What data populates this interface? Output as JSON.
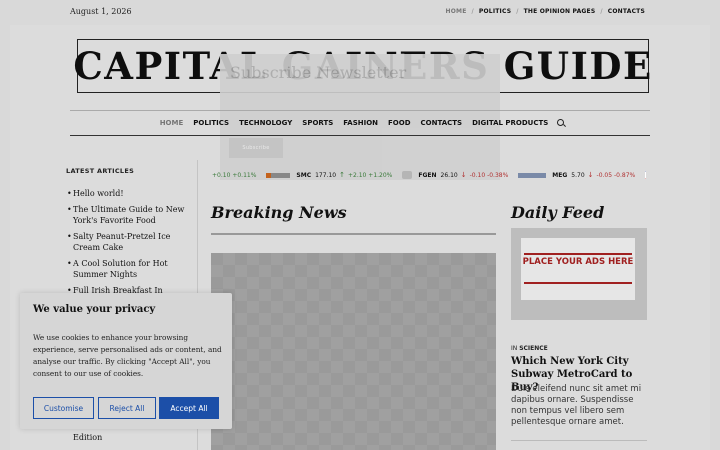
{
  "topbar": {
    "date": "August 1, 2026",
    "nav": [
      "HOME",
      "POLITICS",
      "THE OPINION PAGES",
      "CONTACTS"
    ]
  },
  "logo": {
    "title": "CAPITAL GAINERS GUIDE"
  },
  "newsletter_popup": {
    "title": "Subscribe Newsletter",
    "button": "Subscribe"
  },
  "mainnav": {
    "items": [
      "HOME",
      "POLITICS",
      "TECHNOLOGY",
      "SPORTS",
      "FASHION",
      "FOOD",
      "CONTACTS",
      "DIGITAL PRODUCTS"
    ],
    "search_icon": "search-icon"
  },
  "sidebar": {
    "title": "LATEST ARTICLES",
    "articles": [
      "Hello world!",
      "The Ultimate Guide to New York's Favorite Food",
      "Salty Peanut-Pretzel Ice Cream Cake",
      "A Cool Solution for Hot Summer Nights",
      "Full Irish Breakfast In"
    ],
    "tail": "Edition"
  },
  "ticker": {
    "items": [
      {
        "sym": "",
        "price": "",
        "change": "+0.10",
        "pct": "+0.11%",
        "dir": "up"
      },
      {
        "sym": "SMC",
        "price": "177.10",
        "change": "+2.10",
        "pct": "+1.20%",
        "dir": "up"
      },
      {
        "sym": "FGEN",
        "price": "26.10",
        "change": "-0.10",
        "pct": "-0.38%",
        "dir": "down"
      },
      {
        "sym": "MEG",
        "price": "5.70",
        "change": "-0.05",
        "pct": "-0.87%",
        "dir": "down"
      },
      {
        "sym": "A",
        "price": "",
        "change": "",
        "pct": "",
        "dir": "none"
      }
    ],
    "colors": {
      "up": "#3a7a3a",
      "down": "#b03030"
    }
  },
  "breaking": {
    "heading": "Breaking News"
  },
  "daily": {
    "heading": "Daily Feed",
    "ad_text": "PLACE YOUR ADS HERE",
    "category_prefix": "IN",
    "category": "SCIENCE",
    "title": "Which New York City Subway MetroCard to Buy?",
    "excerpt": "Duis eleifend nunc sit amet mi dapibus ornare. Suspendisse non tempus vel libero sem pellentesque ornare amet."
  },
  "cookie": {
    "title": "We value your privacy",
    "body": "We use cookies to enhance your browsing experience, serve personalised ads or content, and analyse our traffic. By clicking \"Accept All\", you consent to our use of cookies.",
    "customise": "Customise",
    "reject": "Reject All",
    "accept": "Accept All",
    "accent": "#1c4fa8"
  }
}
